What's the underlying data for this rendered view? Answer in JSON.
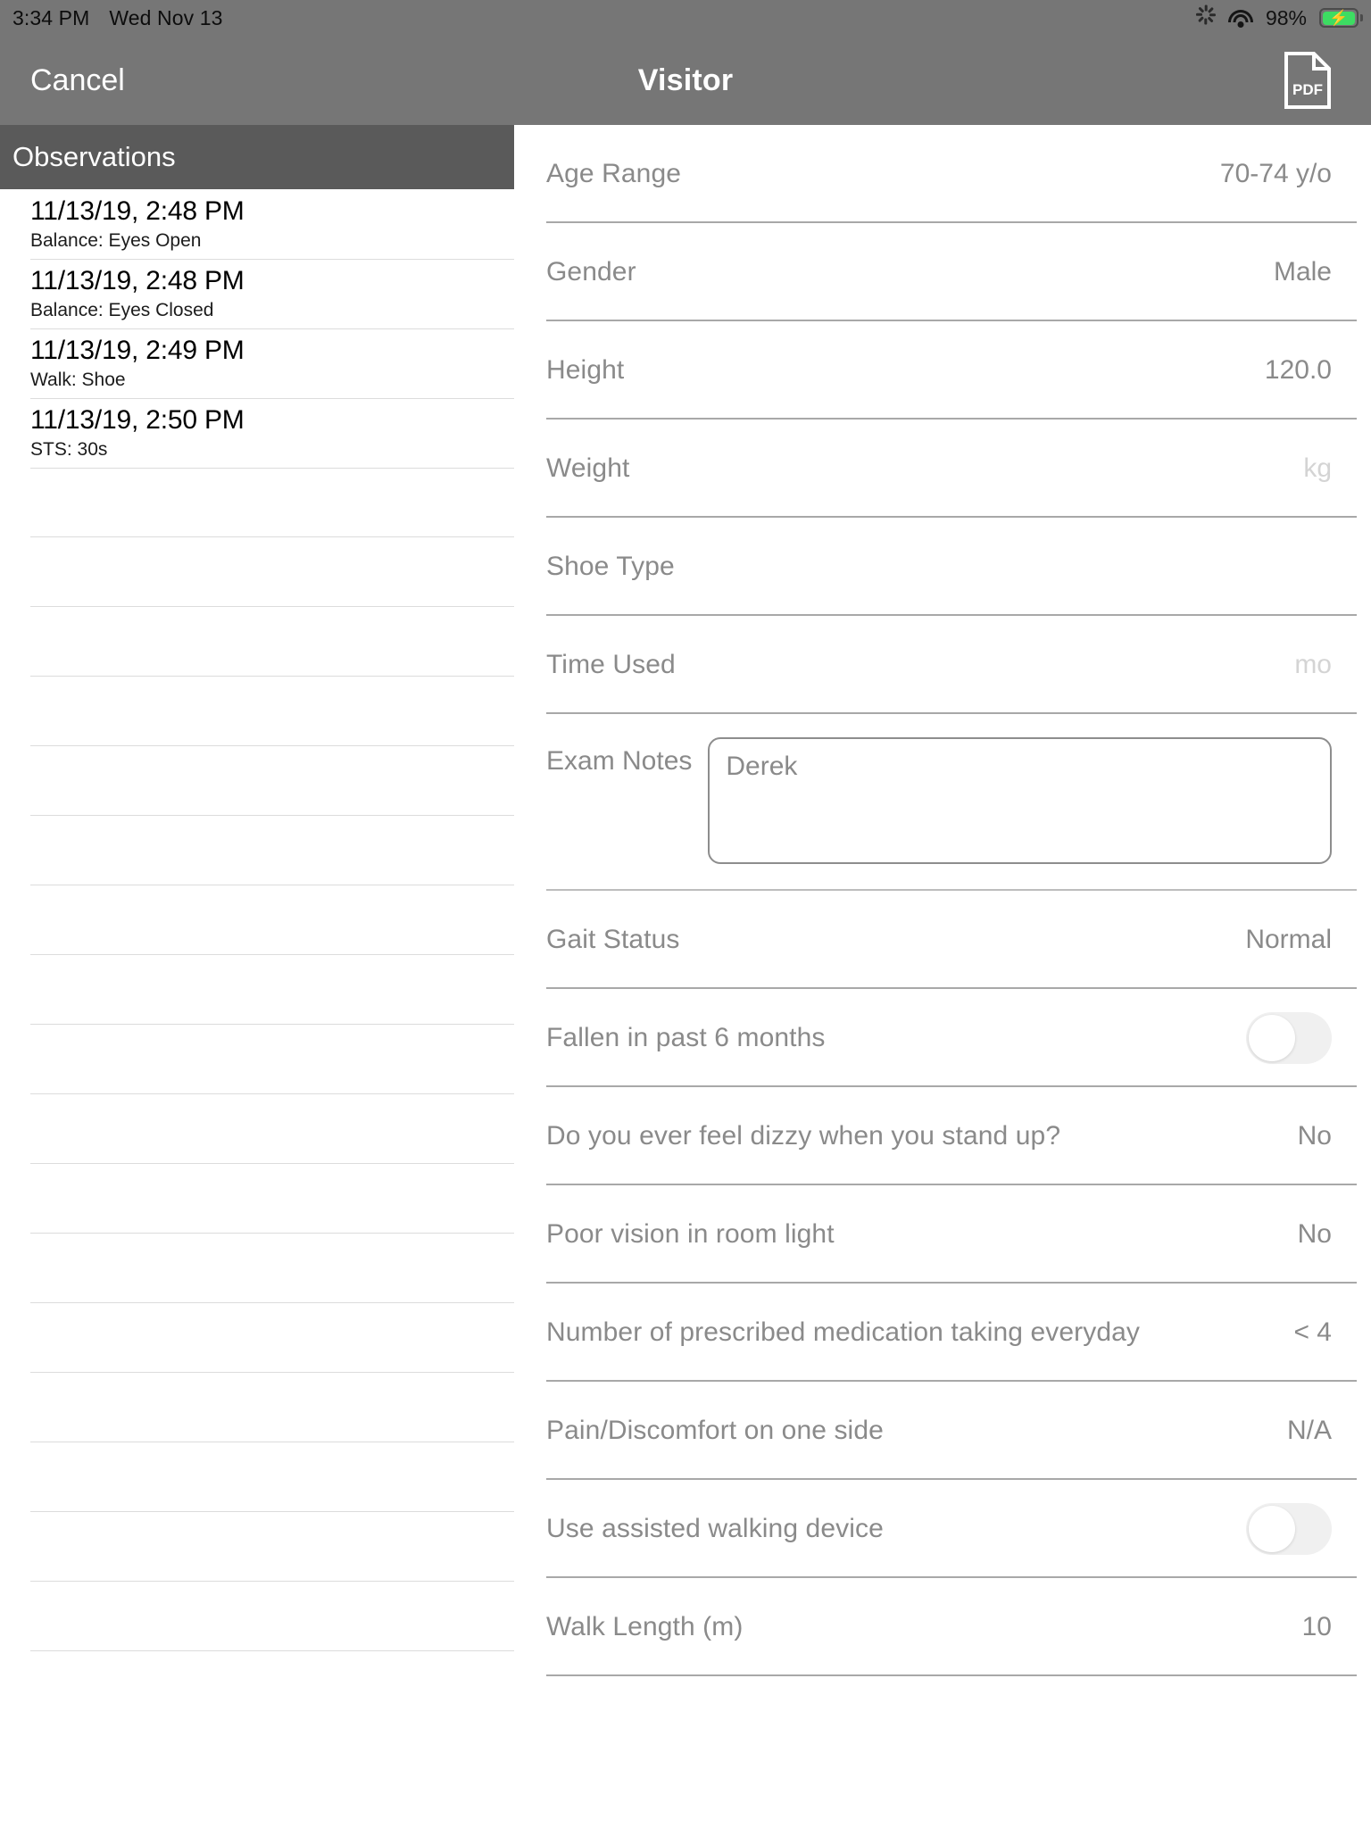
{
  "statusbar": {
    "time": "3:34 PM",
    "date": "Wed Nov 13",
    "battery_percent": "98%",
    "icons": [
      "sunburst-icon",
      "wifi-icon",
      "battery-charging-icon"
    ]
  },
  "navbar": {
    "cancel_label": "Cancel",
    "title": "Visitor",
    "pdf_label": "PDF"
  },
  "sidebar": {
    "header": "Observations",
    "items": [
      {
        "timestamp": "11/13/19, 2:48 PM",
        "subtitle": "Balance: Eyes Open"
      },
      {
        "timestamp": "11/13/19, 2:48 PM",
        "subtitle": "Balance: Eyes Closed"
      },
      {
        "timestamp": "11/13/19, 2:49 PM",
        "subtitle": "Walk: Shoe"
      },
      {
        "timestamp": "11/13/19, 2:50 PM",
        "subtitle": "STS: 30s"
      }
    ],
    "empty_row_count": 17
  },
  "form": {
    "rows": [
      {
        "label": "Age Range",
        "value": "70-74 y/o",
        "kind": "value"
      },
      {
        "label": "Gender",
        "value": "Male",
        "kind": "value"
      },
      {
        "label": "Height",
        "value": "120.0",
        "kind": "value"
      },
      {
        "label": "Weight",
        "value": "kg",
        "kind": "placeholder"
      },
      {
        "label": "Shoe Type",
        "value": "",
        "kind": "value"
      },
      {
        "label": "Time Used",
        "value": "mo",
        "kind": "placeholder"
      }
    ],
    "notes": {
      "label": "Exam Notes",
      "value": "Derek"
    },
    "rows2": [
      {
        "label": "Gait Status",
        "value": "Normal",
        "kind": "value"
      },
      {
        "label": "Fallen in past 6 months",
        "value": "",
        "kind": "toggle",
        "on": false
      },
      {
        "label": "Do you ever feel dizzy when you stand up?",
        "value": "No",
        "kind": "value"
      },
      {
        "label": "Poor vision in room light",
        "value": "No",
        "kind": "value"
      },
      {
        "label": "Number of prescribed medication taking everyday",
        "value": "< 4",
        "kind": "value"
      },
      {
        "label": "Pain/Discomfort on one side",
        "value": "N/A",
        "kind": "value"
      },
      {
        "label": "Use assisted walking device",
        "value": "",
        "kind": "toggle",
        "on": false
      },
      {
        "label": "Walk Length (m)",
        "value": "10",
        "kind": "value"
      }
    ]
  },
  "colors": {
    "chrome": "#767676",
    "sidebar_header": "#5a5a5a",
    "label_gray": "#8a8a8a",
    "placeholder_gray": "#d4d4d4",
    "separator": "#a8a8a8",
    "battery_green": "#3ddc62"
  }
}
